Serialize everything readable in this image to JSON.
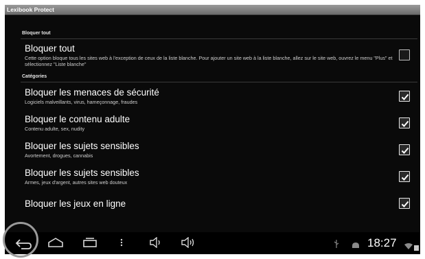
{
  "app": {
    "title": "Lexibook Protect"
  },
  "sections": {
    "block_all_header": "Bloquer tout",
    "categories_header": "Catégories"
  },
  "settings": [
    {
      "label": "Bloquer tout",
      "summary": "Cette option bloque tous les sites web à l'exception de ceux de la liste blanche. Pour ajouter un site web à la liste blanche, allez sur le site web, ouvrez le menu \"Plus\" et sélectionnez \"Liste blanche\"",
      "checked": false
    },
    {
      "label": "Bloquer les menaces de sécurité",
      "summary": "Logiciels malveillants, virus, hameçonnage, fraudes",
      "checked": true
    },
    {
      "label": "Bloquer le contenu adulte",
      "summary": "Contenu adulte, sex, nudity",
      "checked": true
    },
    {
      "label": "Bloquer les sujets sensibles",
      "summary": "Avortement, drogues, cannabis",
      "checked": true
    },
    {
      "label": "Bloquer les sujets sensibles",
      "summary": "Armes, jeux d'argent, autres sites web douteux",
      "checked": true
    },
    {
      "label": "Bloquer les jeux en ligne",
      "summary": "",
      "checked": true
    }
  ],
  "status_bar": {
    "time": "18:27"
  },
  "nav_icons": [
    "back-icon",
    "home-icon",
    "recent-apps-icon",
    "menu-icon",
    "volume-down-icon",
    "volume-up-icon",
    "usb-icon",
    "android-icon",
    "wifi-icon",
    "battery-icon"
  ]
}
